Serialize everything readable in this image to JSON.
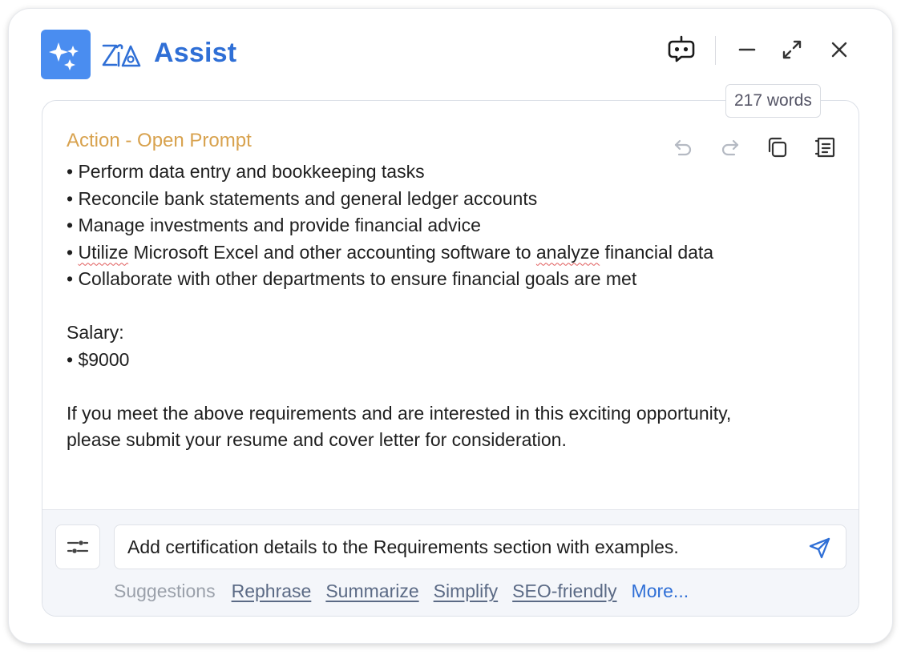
{
  "header": {
    "app_title": "Assist",
    "icons": [
      "sparkles-icon",
      "brand-logo-icon",
      "chatbot-icon",
      "minimize-icon",
      "expand-icon",
      "close-icon"
    ]
  },
  "word_count": "217 words",
  "editor": {
    "action_label": "Action - Open Prompt",
    "toolbar_icons": [
      "undo-icon",
      "redo-icon",
      "copy-icon",
      "insert-icon"
    ],
    "lines": {
      "l0": "• Perform data entry and bookkeeping tasks",
      "l1": "• Reconcile bank statements and general ledger accounts",
      "l2": "• Manage investments and provide financial advice",
      "l3_a": "• ",
      "l3_b": "Utilize",
      "l3_c": " Microsoft Excel and other accounting software to ",
      "l3_d": "analyze",
      "l3_e": " financial data",
      "l4": "• Collaborate with other departments to ensure financial goals are met",
      "l5": "Salary:",
      "l6": "• $9000",
      "l7": "If you meet the above requirements and are interested in this exciting opportunity,",
      "l8": "please submit your resume and cover letter for consideration."
    }
  },
  "footer": {
    "prompt_value": "Add certification details to the Requirements section with examples.",
    "suggestions_label": "Suggestions",
    "suggestions": {
      "s0": "Rephrase",
      "s1": "Summarize",
      "s2": "Simplify",
      "s3": "SEO-friendly"
    },
    "more_label": "More..."
  },
  "colors": {
    "accent_blue": "#2f6fd6",
    "logo_tile": "#4a8df0",
    "action_label": "#d8a24e",
    "spellcheck": "#e05a5a"
  }
}
